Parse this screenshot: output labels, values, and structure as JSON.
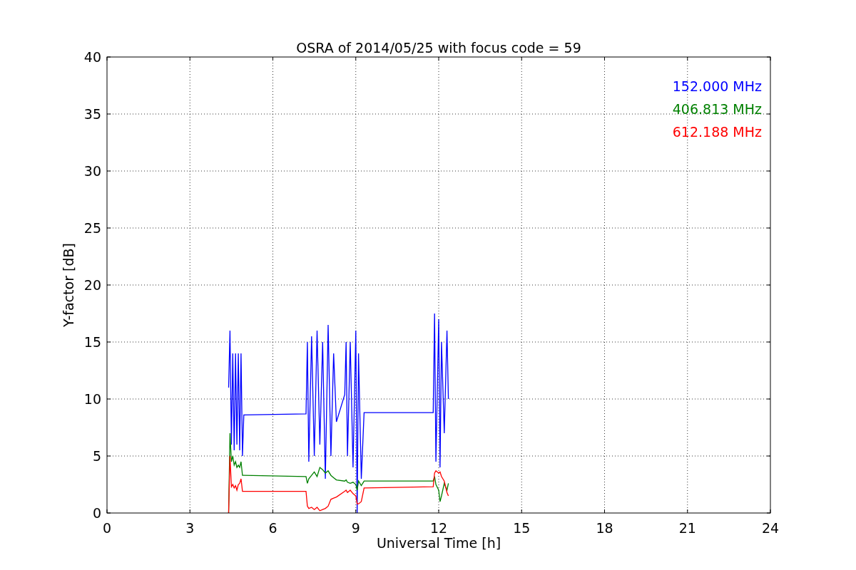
{
  "figure": {
    "chart_data": {
      "type": "line",
      "title": "OSRA of 2014/05/25 with focus code = 59",
      "xlabel": "Universal Time [h]",
      "ylabel": "Y-factor [dB]",
      "x": [
        4.4,
        4.45,
        4.5,
        4.55,
        4.6,
        4.65,
        4.7,
        4.75,
        4.8,
        4.85,
        4.9,
        4.95,
        7.2,
        7.25,
        7.3,
        7.4,
        7.5,
        7.6,
        7.7,
        7.8,
        7.9,
        8.0,
        8.1,
        8.2,
        8.3,
        8.6,
        8.65,
        8.7,
        8.8,
        8.9,
        9.0,
        9.05,
        9.1,
        9.2,
        9.3,
        11.8,
        11.85,
        11.9,
        12.0,
        12.05,
        12.1,
        12.2,
        12.3,
        12.35
      ],
      "series": [
        {
          "name": "152.000 MHz",
          "color": "#0000ff",
          "values": [
            11,
            16,
            6,
            14,
            5.5,
            14,
            6,
            14,
            5.5,
            14,
            5,
            8.6,
            8.7,
            15,
            4.5,
            15.5,
            5,
            16,
            6,
            15,
            3,
            16.5,
            5,
            14,
            8,
            10.4,
            15,
            5,
            15,
            4,
            16,
            0,
            14,
            3,
            8.8,
            8.8,
            17.5,
            4.5,
            17,
            4,
            15,
            7,
            16,
            10
          ]
        },
        {
          "name": "406.813 MHz",
          "color": "#008000",
          "values": [
            0,
            7,
            4.5,
            5,
            4.2,
            4.5,
            4,
            4.2,
            4,
            4.5,
            3.3,
            3.3,
            3.2,
            2.6,
            3,
            3.3,
            3.6,
            3.2,
            4,
            3.8,
            3.5,
            3.7,
            3.3,
            3.1,
            2.9,
            2.8,
            2.9,
            2.7,
            2.6,
            2.7,
            2.5,
            2,
            2.8,
            2.4,
            2.8,
            2.8,
            3.2,
            2.5,
            2,
            1,
            1.5,
            2.6,
            2,
            2.6
          ]
        },
        {
          "name": "612.188 MHz",
          "color": "#ff0000",
          "values": [
            0,
            5,
            2.3,
            2.5,
            2.2,
            2.4,
            2,
            2.5,
            2.6,
            3,
            1.9,
            1.9,
            1.9,
            0.6,
            0.4,
            0.5,
            0.3,
            0.5,
            0.2,
            0.3,
            0.4,
            0.6,
            1.2,
            1.3,
            1.4,
            1.9,
            2,
            1.8,
            2,
            1.7,
            1.5,
            0.8,
            0.8,
            1,
            2.2,
            2.3,
            3.5,
            3.7,
            3.5,
            3.6,
            3.2,
            2.8,
            1.8,
            1.5
          ]
        }
      ],
      "grid": true,
      "xlim": [
        0,
        24
      ],
      "ylim": [
        0,
        40
      ],
      "xticks": [
        0,
        3,
        6,
        9,
        12,
        15,
        18,
        21,
        24
      ],
      "yticks": [
        0,
        5,
        10,
        15,
        20,
        25,
        30,
        35,
        40
      ]
    }
  }
}
